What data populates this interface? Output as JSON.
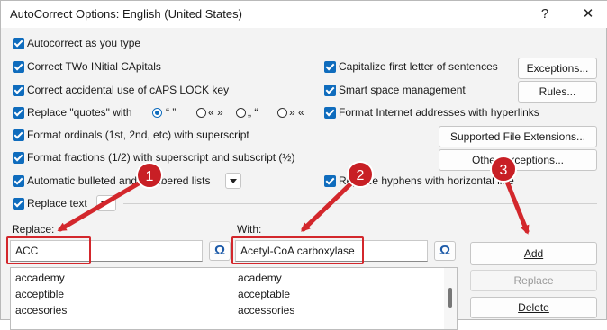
{
  "window": {
    "title": "AutoCorrect Options: English (United States)",
    "help": "?",
    "close": "✕"
  },
  "left_options": [
    {
      "label": "Autocorrect as you type",
      "checked": true
    },
    {
      "label": "Correct TWo INitial CApitals",
      "checked": true
    },
    {
      "label": "Correct accidental use of cAPS LOCK key",
      "checked": true
    },
    {
      "label": "Replace \"quotes\" with",
      "checked": true
    },
    {
      "label": "Format ordinals (1st, 2nd, etc) with superscript",
      "checked": true
    },
    {
      "label": "Format fractions (1/2) with superscript and subscript (½)",
      "checked": true
    },
    {
      "label": "Automatic bulleted and numbered lists",
      "checked": true
    },
    {
      "label": "Replace text",
      "checked": true
    }
  ],
  "quote_styles": [
    "“ ”",
    "« »",
    "„ “",
    "» «"
  ],
  "right_options": [
    {
      "label": "Capitalize first letter of sentences",
      "checked": true
    },
    {
      "label": "Smart space management",
      "checked": true
    },
    {
      "label": "Format Internet addresses with hyperlinks",
      "checked": true
    },
    {
      "label": "Replace hyphens with horizontal line",
      "checked": true
    }
  ],
  "buttons": {
    "exceptions": "Exceptions...",
    "rules": "Rules...",
    "supported_ext": "Supported File Extensions...",
    "other_exceptions": "Other Exceptions...",
    "add": "Add",
    "replace": "Replace",
    "delete": "Delete"
  },
  "replace_label": "Replace:",
  "with_label": "With:",
  "replace_value": "ACC",
  "with_value": "Acetyl-CoA carboxylase",
  "omega": "Ω",
  "entries": [
    {
      "from": "accademy",
      "to": "academy"
    },
    {
      "from": "acceptible",
      "to": "acceptable"
    },
    {
      "from": "accesories",
      "to": "accessories"
    }
  ],
  "callouts": [
    "1",
    "2",
    "3"
  ],
  "colors": {
    "accent": "#0f6cbd",
    "callout": "#d3272c"
  }
}
